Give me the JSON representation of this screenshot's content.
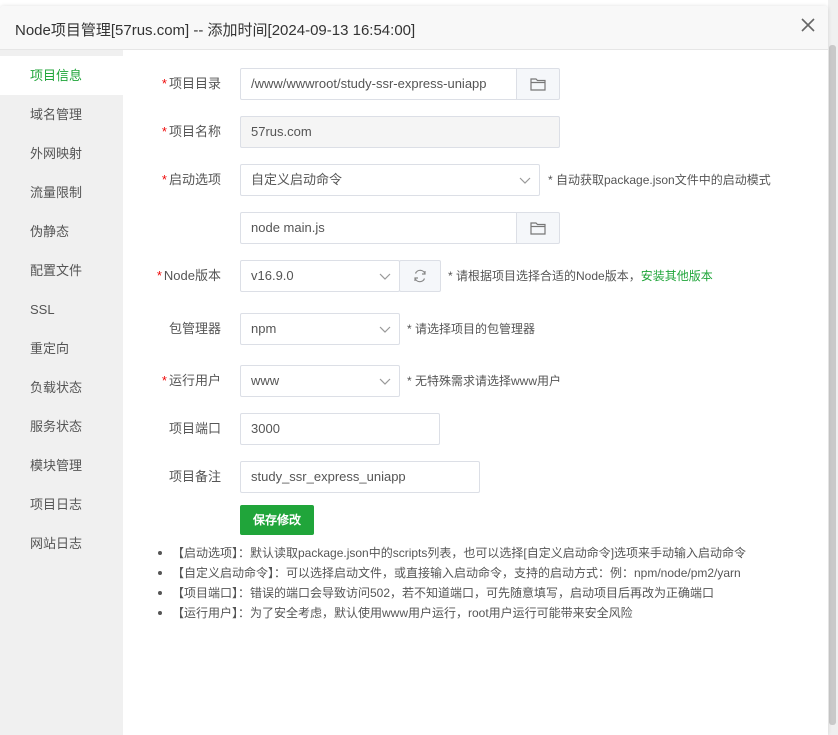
{
  "dialog": {
    "title": "Node项目管理[57rus.com] -- 添加时间[2024-09-13 16:54:00]"
  },
  "sidebar": {
    "items": [
      {
        "label": "项目信息",
        "active": true
      },
      {
        "label": "域名管理"
      },
      {
        "label": "外网映射"
      },
      {
        "label": "流量限制"
      },
      {
        "label": "伪静态"
      },
      {
        "label": "配置文件"
      },
      {
        "label": "SSL"
      },
      {
        "label": "重定向"
      },
      {
        "label": "负载状态"
      },
      {
        "label": "服务状态"
      },
      {
        "label": "模块管理"
      },
      {
        "label": "项目日志"
      },
      {
        "label": "网站日志"
      }
    ]
  },
  "form": {
    "required_mark": "*",
    "project_dir": {
      "label": "项目目录",
      "value": "/www/wwwroot/study-ssr-express-uniapp"
    },
    "project_name": {
      "label": "项目名称",
      "value": "57rus.com"
    },
    "start_option": {
      "label": "启动选项",
      "value": "自定义启动命令",
      "hint": "* 自动获取package.json文件中的启动模式"
    },
    "start_command": {
      "value": "node main.js"
    },
    "node_version": {
      "label": "Node版本",
      "value": "v16.9.0",
      "hint": "* 请根据项目选择合适的Node版本，",
      "link": "安装其他版本"
    },
    "package_manager": {
      "label": "包管理器",
      "value": "npm",
      "hint": "* 请选择项目的包管理器"
    },
    "run_user": {
      "label": "运行用户",
      "value": "www",
      "hint": "* 无特殊需求请选择www用户"
    },
    "project_port": {
      "label": "项目端口",
      "value": "3000"
    },
    "project_note": {
      "label": "项目备注",
      "value": "study_ssr_express_uniapp"
    },
    "save_label": "保存修改"
  },
  "notes": [
    "【启动选项】：默认读取package.json中的scripts列表，也可以选择[自定义启动命令]选项来手动输入启动命令",
    "【自定义启动命令】：可以选择启动文件，或直接输入启动命令，支持的启动方式：例：npm/node/pm2/yarn",
    "【项目端口】：错误的端口会导致访问502，若不知道端口，可先随意填写，启动项目后再改为正确端口",
    "【运行用户】：为了安全考虑，默认使用www用户运行，root用户运行可能带来安全风险"
  ],
  "colors": {
    "accent": "#20a53a",
    "required": "#ef0808",
    "sidebar_bg": "#f0f0f0"
  },
  "icons": {
    "folder": "folder-icon",
    "refresh": "refresh-icon",
    "close": "close-icon",
    "caret": "chevron-down-icon"
  }
}
